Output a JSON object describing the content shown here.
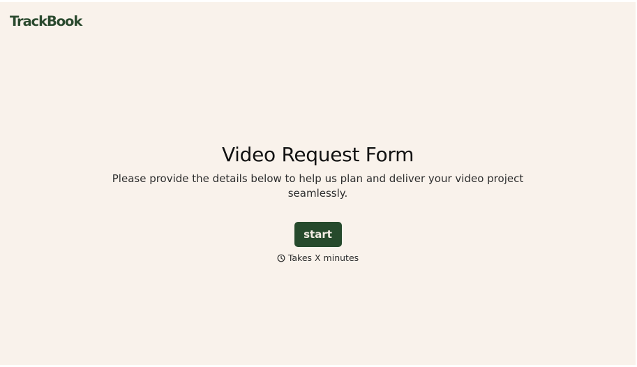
{
  "brand": {
    "name": "TrackBook"
  },
  "form": {
    "title": "Video Request Form",
    "description": "Please provide the details below to help us plan and deliver your video project seamlessly.",
    "start_label": "start",
    "duration_text": "Takes X minutes",
    "duration_icon": "clock-icon"
  },
  "colors": {
    "background": "#f9f2eb",
    "brand_green": "#264a2c",
    "button_text": "#f3ede4"
  }
}
